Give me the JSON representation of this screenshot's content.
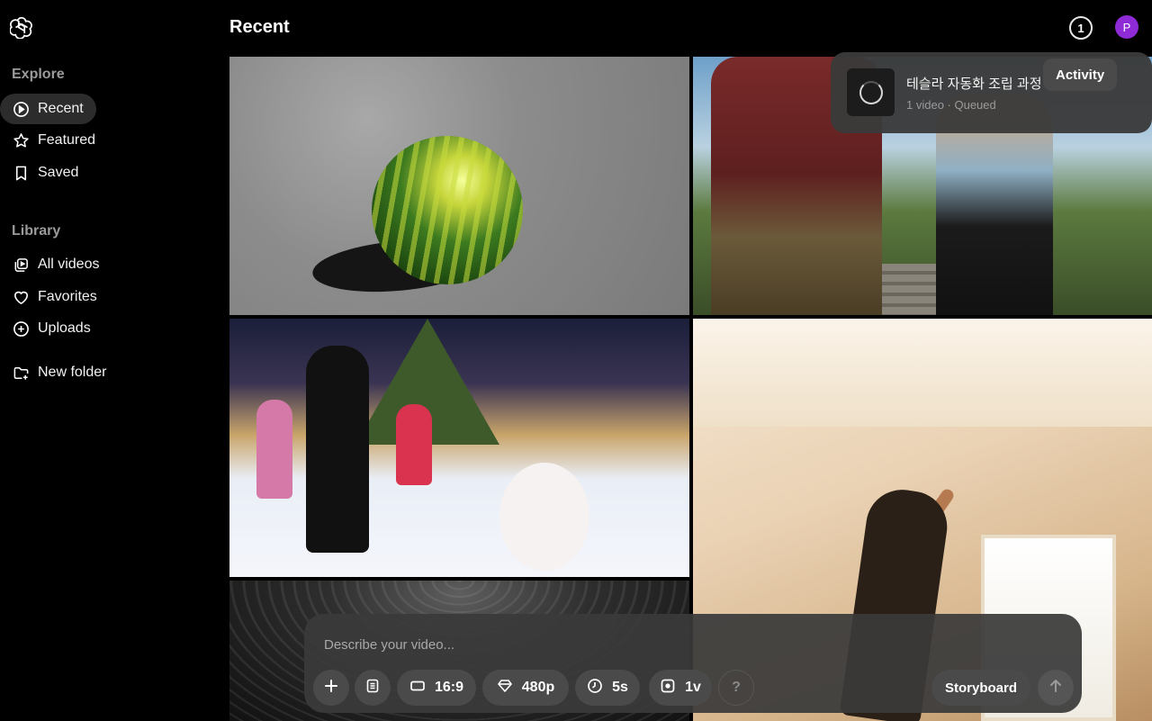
{
  "sidebar": {
    "explore_title": "Explore",
    "explore_items": [
      {
        "label": "Recent",
        "icon": "play-circle-icon",
        "active": true
      },
      {
        "label": "Featured",
        "icon": "star-icon"
      },
      {
        "label": "Saved",
        "icon": "bookmark-icon"
      }
    ],
    "library_title": "Library",
    "library_items": [
      {
        "label": "All videos",
        "icon": "videos-stack-icon"
      },
      {
        "label": "Favorites",
        "icon": "heart-icon"
      },
      {
        "label": "Uploads",
        "icon": "plus-circle-icon"
      }
    ],
    "new_folder_label": "New folder"
  },
  "header": {
    "title": "Recent",
    "notification_count": "1",
    "avatar_initial": "P",
    "avatar_color": "#8e2bd6"
  },
  "activity": {
    "tooltip": "Activity",
    "item_title": "테슬라 자동화 조립 과정",
    "item_subtitle": "1 video · Queued"
  },
  "composer": {
    "placeholder": "Describe your video...",
    "aspect": "16:9",
    "resolution": "480p",
    "duration": "5s",
    "variations": "1v",
    "help": "?",
    "storyboard_label": "Storyboard"
  }
}
